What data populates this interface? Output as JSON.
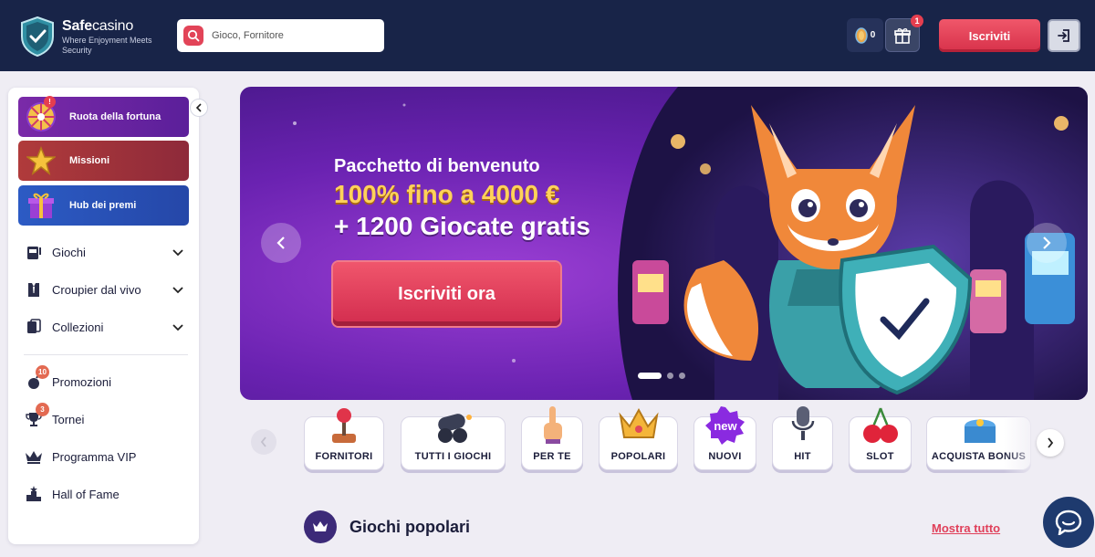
{
  "header": {
    "logo_bold": "Safe",
    "logo_light": "casino",
    "logo_tagline": "Where Enjoyment Meets Security",
    "search_placeholder": "Gioco, Fornitore",
    "balance": "0",
    "gift_badge": "1",
    "signup_label": "Iscriviti"
  },
  "sidebar": {
    "promos": [
      {
        "label": "Ruota della fortuna",
        "badge": "!"
      },
      {
        "label": "Missioni"
      },
      {
        "label": "Hub dei premi"
      }
    ],
    "nav": [
      {
        "label": "Giochi"
      },
      {
        "label": "Croupier dal vivo"
      },
      {
        "label": "Collezioni"
      }
    ],
    "links": [
      {
        "label": "Promozioni",
        "badge": "10"
      },
      {
        "label": "Tornei",
        "badge": "3"
      },
      {
        "label": "Programma VIP"
      },
      {
        "label": "Hall of Fame"
      }
    ]
  },
  "banner": {
    "subtitle": "Pacchetto di benvenuto",
    "line1": "100% fino a 4000 €",
    "line2": "+ 1200 Giocate gratis",
    "cta": "Iscriviti ora"
  },
  "categories": [
    {
      "label": "FORNITORI",
      "icon": "joystick-icon"
    },
    {
      "label": "TUTTI I GIOCHI",
      "icon": "cannon-icon"
    },
    {
      "label": "PER TE",
      "icon": "pointing-hand-icon"
    },
    {
      "label": "POPOLARI",
      "icon": "crown-icon"
    },
    {
      "label": "NUOVI",
      "icon": "new-badge-icon",
      "badge_text": "new"
    },
    {
      "label": "HIT",
      "icon": "microphone-icon"
    },
    {
      "label": "SLOT",
      "icon": "cherries-icon"
    },
    {
      "label": "ACQUISTA BONUS",
      "icon": "treasure-chest-icon"
    }
  ],
  "popular": {
    "title": "Giochi popolari",
    "link": "Mostra tutto"
  },
  "colors": {
    "header_bg": "#182448",
    "accent_red": "#e0405a",
    "banner_purple": "#6a22b1",
    "gold": "#ffd25a"
  }
}
